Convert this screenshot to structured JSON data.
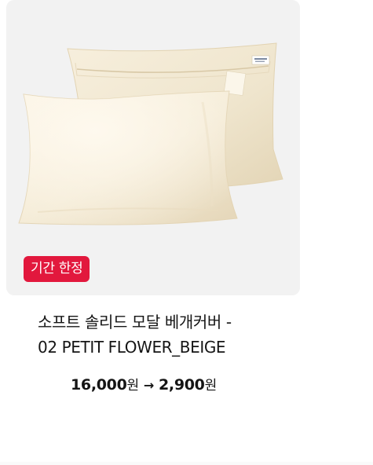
{
  "product": {
    "image_alt": "소프트 솔리드 모달 베개커버 - 02 PETIT FLOWER_BEIGE",
    "badge": "기간 한정",
    "title_line1": "소프트 솔리드 모달 베개커버 -",
    "title_line2": "02 PETIT FLOWER_BEIGE",
    "original_price": "16,000",
    "sale_price": "2,900",
    "currency": "원",
    "arrow": "→",
    "colors": {
      "badge_bg": "#e2183d",
      "pillow": "#f6eedb",
      "card_bg": "#f2f2f2"
    }
  }
}
